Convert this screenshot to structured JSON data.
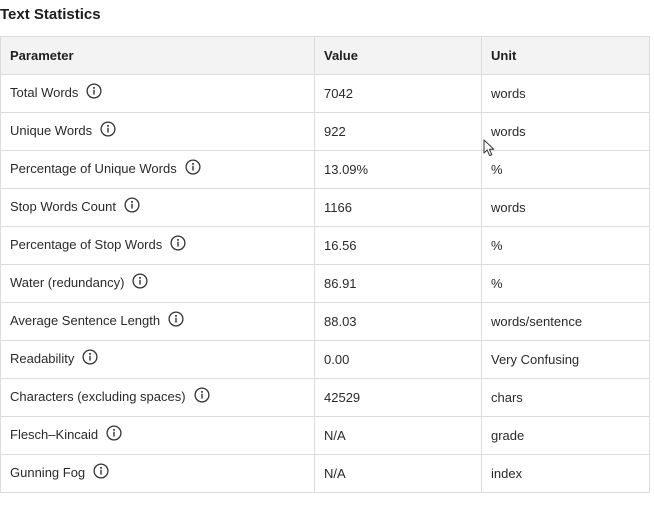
{
  "title": "Text Statistics",
  "table": {
    "headers": [
      "Parameter",
      "Value",
      "Unit"
    ],
    "rows": [
      {
        "parameter": "Total Words",
        "value": "7042",
        "unit": "words"
      },
      {
        "parameter": "Unique Words",
        "value": "922",
        "unit": "words"
      },
      {
        "parameter": "Percentage of Unique Words",
        "value": "13.09%",
        "unit": "%"
      },
      {
        "parameter": "Stop Words Count",
        "value": "1166",
        "unit": "words"
      },
      {
        "parameter": "Percentage of Stop Words",
        "value": "16.56",
        "unit": "%"
      },
      {
        "parameter": "Water (redundancy)",
        "value": "86.91",
        "unit": "%"
      },
      {
        "parameter": "Average Sentence Length",
        "value": "88.03",
        "unit": "words/sentence"
      },
      {
        "parameter": "Readability",
        "value": "0.00",
        "unit": "Very Confusing"
      },
      {
        "parameter": "Characters (excluding spaces)",
        "value": "42529",
        "unit": "chars"
      },
      {
        "parameter": "Flesch–Kincaid",
        "value": "N/A",
        "unit": "grade"
      },
      {
        "parameter": "Gunning Fog",
        "value": "N/A",
        "unit": "index"
      }
    ]
  },
  "icons": {
    "row_icon": "info-icon",
    "pointer": "mouse-cursor-icon"
  }
}
